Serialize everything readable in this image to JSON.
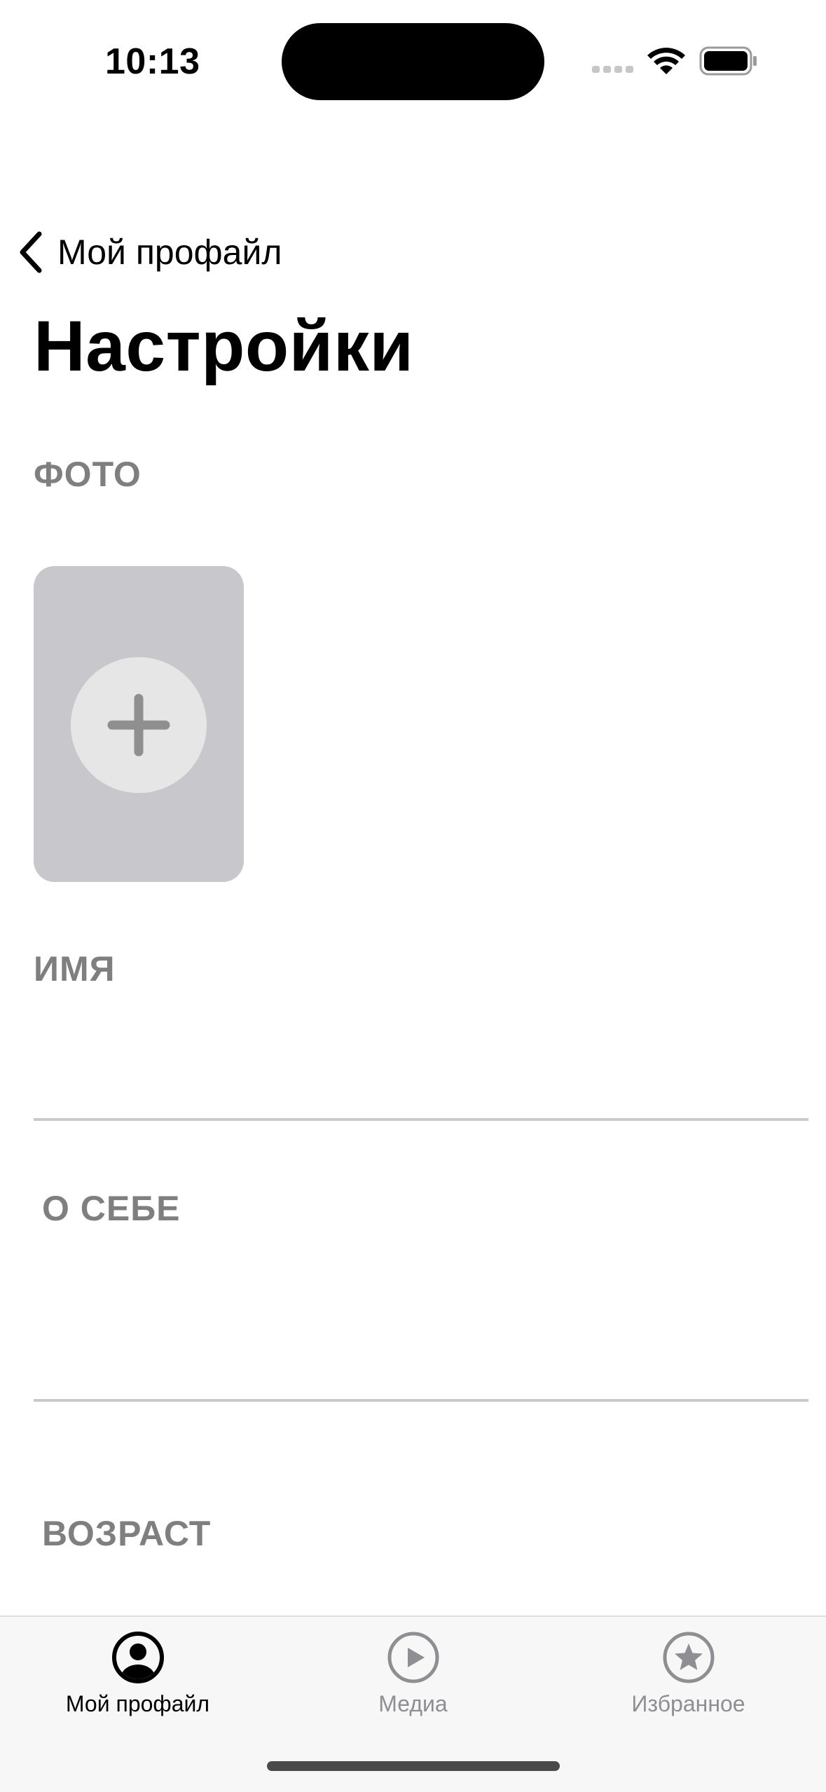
{
  "status_bar": {
    "time": "10:13"
  },
  "nav": {
    "back_label": "Мой профайл",
    "title": "Настройки"
  },
  "sections": {
    "photo_label": "ФОТО",
    "name_label": "ИМЯ",
    "about_label": "О СЕБЕ",
    "age_label": "ВОЗРАСТ"
  },
  "fields": {
    "name_value": "",
    "about_value": "",
    "age_value": ""
  },
  "tab_bar": {
    "items": [
      {
        "label": "Мой профайл",
        "icon": "person-circle-icon",
        "active": true
      },
      {
        "label": "Медиа",
        "icon": "play-circle-icon",
        "active": false
      },
      {
        "label": "Избранное",
        "icon": "star-circle-icon",
        "active": false
      }
    ]
  },
  "colors": {
    "section_label": "#7f7f7f",
    "photo_slot_bg": "#c8c8cc",
    "tab_inactive": "#8e8e93"
  }
}
